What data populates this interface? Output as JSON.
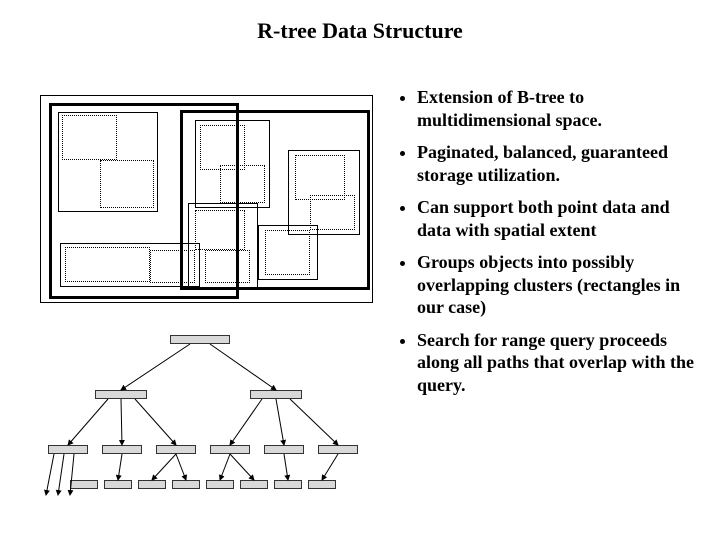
{
  "title": "R-tree Data Structure",
  "bullets": [
    "Extension of B-tree to multidimensional space.",
    "Paginated, balanced, guaranteed storage utilization.",
    "Can support both point data and data with spatial extent",
    "Groups objects into possibly overlapping clusters (rectangles in our case)",
    "Search for range query proceeds along all paths that overlap with the query."
  ]
}
